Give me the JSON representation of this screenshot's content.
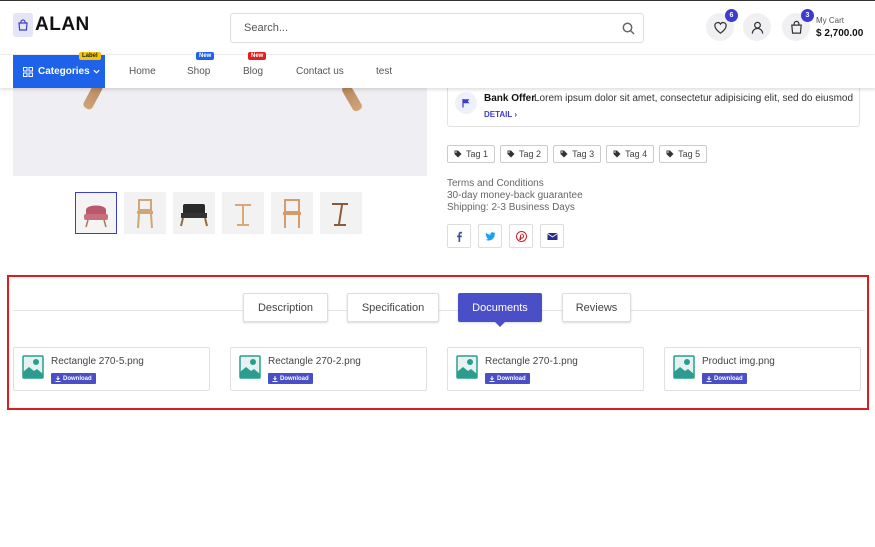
{
  "header": {
    "logo_text": "ALAN",
    "search_placeholder": "Search...",
    "wishlist_count": "6",
    "cart_count": "3",
    "cart_label": "My Cart",
    "cart_total": "$ 2,700.00"
  },
  "nav": {
    "categories_label": "Categories",
    "categories_badge": "Label",
    "items": [
      {
        "label": "Home",
        "badge": ""
      },
      {
        "label": "Shop",
        "badge": "New"
      },
      {
        "label": "Blog",
        "badge": "New"
      },
      {
        "label": "Contact us",
        "badge": ""
      },
      {
        "label": "test",
        "badge": ""
      }
    ]
  },
  "offer": {
    "title": "Bank Offer",
    "text": "Lorem ipsum dolor sit amet, consectetur adipisicing elit, sed do eiusmod",
    "link": "DETAIL"
  },
  "tags": [
    "Tag 1",
    "Tag 2",
    "Tag 3",
    "Tag 4",
    "Tag 5"
  ],
  "terms": {
    "line1": "Terms and Conditions",
    "line2": "30-day money-back guarantee",
    "line3": "Shipping: 2-3 Business Days"
  },
  "socials": [
    "facebook-icon",
    "twitter-icon",
    "pinterest-icon",
    "envelope-icon"
  ],
  "tabs": [
    {
      "label": "Description",
      "active": false
    },
    {
      "label": "Specification",
      "active": false
    },
    {
      "label": "Documents",
      "active": true
    },
    {
      "label": "Reviews",
      "active": false
    }
  ],
  "documents": [
    {
      "name": "Rectangle 270-5.png",
      "action": "Download"
    },
    {
      "name": "Rectangle 270-2.png",
      "action": "Download"
    },
    {
      "name": "Rectangle 270-1.png",
      "action": "Download"
    },
    {
      "name": "Product img.png",
      "action": "Download"
    }
  ],
  "colors": {
    "accent": "#4a4fc7",
    "categories_bg": "#1f62ea",
    "highlight_border": "#e01b1b"
  }
}
